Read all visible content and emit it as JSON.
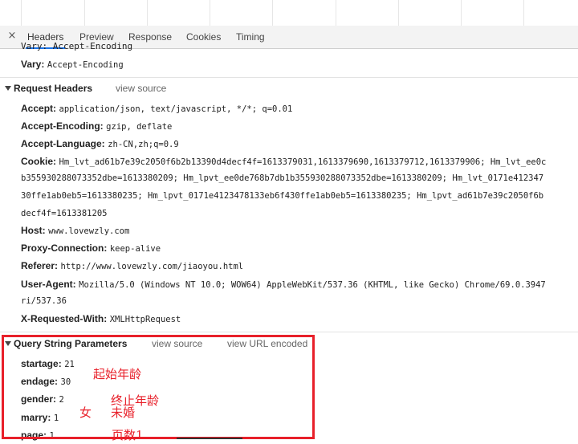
{
  "tabs": {
    "close": "×",
    "items": [
      "Headers",
      "Preview",
      "Response",
      "Cookies",
      "Timing"
    ]
  },
  "clipped_row": "Vary: Accept-Encoding",
  "response_tail": {
    "key": "Vary:",
    "value": "Accept-Encoding"
  },
  "request_headers": {
    "title": "Request Headers",
    "view_source": "view source",
    "rows": [
      {
        "key": "Accept:",
        "value": "application/json, text/javascript, */*; q=0.01"
      },
      {
        "key": "Accept-Encoding:",
        "value": "gzip, deflate"
      },
      {
        "key": "Accept-Language:",
        "value": "zh-CN,zh;q=0.9"
      },
      {
        "key": "Cookie:",
        "value": "Hm_lvt_ad61b7e39c2050f6b2b13390d4decf4f=1613379031,1613379690,1613379712,1613379906; Hm_lvt_ee0c"
      }
    ],
    "cookie_wrap": [
      "b355930288073352dbe=1613380209; Hm_lpvt_ee0de768b7db1b355930288073352dbe=1613380209; Hm_lvt_0171e412347",
      "30ffe1ab0eb5=1613380235; Hm_lpvt_0171e4123478133eb6f430ffe1ab0eb5=1613380235; Hm_lpvt_ad61b7e39c2050f6b",
      "decf4f=1613381205"
    ],
    "rows2": [
      {
        "key": "Host:",
        "value": "www.lovewzly.com"
      },
      {
        "key": "Proxy-Connection:",
        "value": "keep-alive"
      },
      {
        "key": "Referer:",
        "value": "http://www.lovewzly.com/jiaoyou.html"
      },
      {
        "key": "User-Agent:",
        "value": "Mozilla/5.0 (Windows NT 10.0; WOW64) AppleWebKit/537.36 (KHTML, like Gecko) Chrome/69.0.3947"
      }
    ],
    "ua_wrap": "ri/537.36",
    "last": {
      "key": "X-Requested-With:",
      "value": "XMLHttpRequest"
    }
  },
  "query_string": {
    "title": "Query String Parameters",
    "view_source": "view source",
    "view_url_encoded": "view URL encoded",
    "params": [
      {
        "key": "startage:",
        "value": "21"
      },
      {
        "key": "endage:",
        "value": "30"
      },
      {
        "key": "gender:",
        "value": "2"
      },
      {
        "key": "marry:",
        "value": "1"
      },
      {
        "key": "page:",
        "value": "1"
      }
    ]
  },
  "annotations": {
    "start_age": "起始年龄",
    "end_age": "终止年龄",
    "female": "女",
    "unmarried": "未婚",
    "page_num": "页数1"
  },
  "colors": {
    "annotation_red": "#e8202a",
    "tab_active": "#1a73e8"
  }
}
